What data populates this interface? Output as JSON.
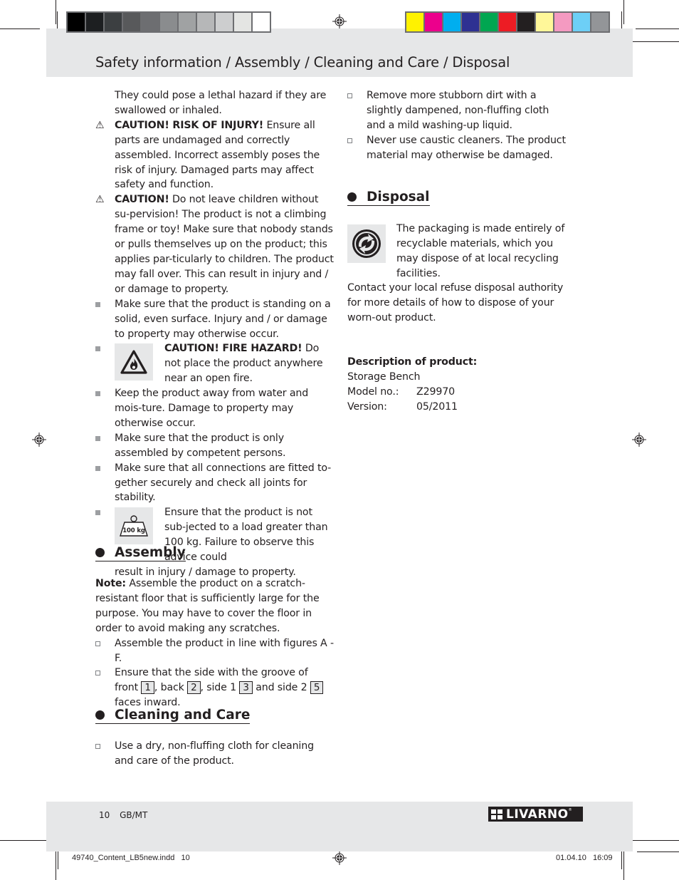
{
  "header": {
    "title": "Safety information / Assembly / Cleaning and Care / Disposal",
    "grayscale_bar": [
      "#000000",
      "#1d1f21",
      "#3c3f41",
      "#58595b",
      "#6d6e71",
      "#8a8c8e",
      "#a0a2a3",
      "#b6b7b8",
      "#cdcecf",
      "#e4e5e3",
      "#ffffff"
    ],
    "color_bar": [
      "#fff200",
      "#ec008c",
      "#00aeef",
      "#2e3192",
      "#00a651",
      "#ed1c24",
      "#231f20",
      "#fff799",
      "#f49ac1",
      "#6dcff6",
      "#939598"
    ]
  },
  "left_column": {
    "intro_text": "They could pose a lethal hazard if they are swallowed or inhaled.",
    "items": [
      {
        "bullet": "warning-triangle",
        "bold": "CAUTION! RISK OF INJURY!",
        "text": " Ensure all parts are undamaged and correctly assembled. Incorrect assembly poses the risk of injury. Damaged parts may affect safety and function."
      },
      {
        "bullet": "warning-triangle",
        "bold": "CAUTION!",
        "text": " Do not leave children without su-pervision! The product is not a climbing frame or toy! Make sure that nobody stands or pulls themselves up on the product; this applies par-ticularly to children. The product may fall over. This can result in injury and / or damage to property."
      },
      {
        "bullet": "square",
        "bold": "",
        "text": "Make sure that the product is standing on a solid, even surface. Injury and / or damage to property may otherwise occur."
      },
      {
        "bullet": "square",
        "icon": "fire-hazard",
        "bold": "CAUTION! FIRE HAZARD!",
        "text": " Do not place the product anywhere near an open fire."
      },
      {
        "bullet": "square",
        "bold": "",
        "text": "Keep the product away from water and mois-ture. Damage to property may otherwise occur."
      },
      {
        "bullet": "square",
        "bold": "",
        "text": "Make sure that the product is only assembled by competent persons."
      },
      {
        "bullet": "square",
        "bold": "",
        "text": "Make sure that all connections are fitted to-gether securely and check all joints for stability."
      },
      {
        "bullet": "square",
        "icon": "weight-100kg",
        "icon_label": "100 kg",
        "bold": "",
        "text": "Ensure that the product is not sub-jected to a load greater than 100 kg. Failure to observe this advice could",
        "continuation": "result in injury / damage to property."
      }
    ]
  },
  "assembly": {
    "heading": "Assembly",
    "note_label": "Note:",
    "note_text": " Assemble the product on a scratch-resistant floor that is sufficiently large for the purpose. You may have to cover the floor in order to avoid making any scratches.",
    "steps": [
      {
        "text": "Assemble the product in line with figures A - F."
      },
      {
        "parts": [
          "Ensure that the side with the groove of front ",
          {
            "box": "1"
          },
          ", back ",
          {
            "box": "2"
          },
          ", side 1 ",
          {
            "box": "3"
          },
          " and side 2 ",
          {
            "box": "5"
          },
          " faces inward."
        ]
      }
    ],
    "step2_text": {
      "a": "Ensure that the side with the groove of front",
      "b": ",",
      "c": "back",
      "d": ", side 1",
      "e": "and side 2",
      "f": "faces inward.",
      "box1": "1",
      "box2": "2",
      "box3": "3",
      "box5": "5"
    }
  },
  "cleaning": {
    "heading": "Cleaning and Care",
    "items": [
      "Use a dry, non-fluffing cloth for cleaning and care of the product.",
      "Remove more stubborn dirt with a slightly dampened, non-fluffing cloth and a mild washing-up liquid.",
      "Never use caustic cleaners. The product material may otherwise be damaged."
    ]
  },
  "disposal": {
    "heading": "Disposal",
    "packaging_text": "The packaging is made entirely of recyclable materials, which you may dispose of at local recycling facilities.",
    "contact_text": "Contact your local refuse disposal authority for more details of how to dispose of your worn-out product.",
    "description": {
      "label": "Description of product:",
      "name": "Storage Bench",
      "model_label": "Model no.:",
      "model_value": "Z29970",
      "version_label": "Version:",
      "version_value": "05/2011"
    }
  },
  "footer": {
    "page_number": "10",
    "locale": "GB/MT",
    "brand": "LIVARNO",
    "slug_file": "49740_Content_LB5new.indd   10",
    "slug_datetime": "01.04.10   16:09"
  }
}
